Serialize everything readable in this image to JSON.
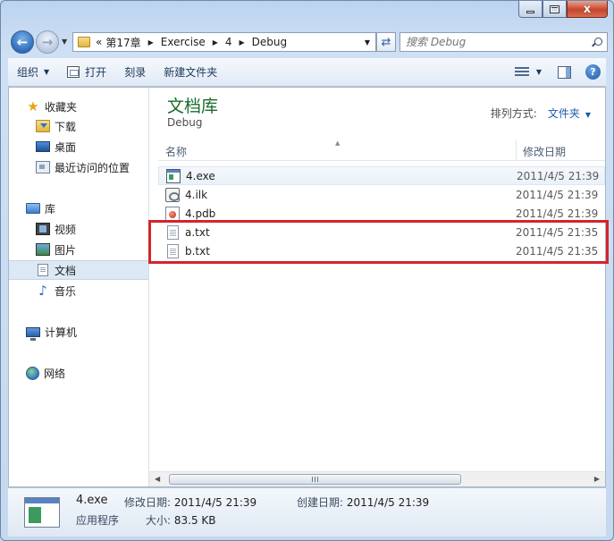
{
  "window": {
    "minimize_label": "",
    "close_glyph": "x"
  },
  "address": {
    "overflow": "«",
    "crumbs": [
      "第17章",
      "Exercise",
      "4",
      "Debug"
    ],
    "search_placeholder": "搜索 Debug"
  },
  "toolbar": {
    "organize": "组织",
    "open": "打开",
    "burn": "刻录",
    "new_folder": "新建文件夹"
  },
  "nav": {
    "favorites": "收藏夹",
    "downloads": "下载",
    "desktop": "桌面",
    "recent": "最近访问的位置",
    "libraries": "库",
    "videos": "视频",
    "pictures": "图片",
    "documents": "文档",
    "music": "音乐",
    "computer": "计算机",
    "network": "网络"
  },
  "library": {
    "title": "文档库",
    "subtitle": "Debug",
    "arrange_label": "排列方式:",
    "arrange_value": "文件夹"
  },
  "columns": {
    "name": "名称",
    "date": "修改日期"
  },
  "files": [
    {
      "name": "4.exe",
      "date": "2011/4/5 21:39",
      "icon": "exe-icon"
    },
    {
      "name": "4.ilk",
      "date": "2011/4/5 21:39",
      "icon": "ilk-icon"
    },
    {
      "name": "4.pdb",
      "date": "2011/4/5 21:39",
      "icon": "pdb-icon"
    },
    {
      "name": "a.txt",
      "date": "2011/4/5 21:35",
      "icon": "txt-icon"
    },
    {
      "name": "b.txt",
      "date": "2011/4/5 21:35",
      "icon": "txt-icon"
    }
  ],
  "details": {
    "name": "4.exe",
    "type": "应用程序",
    "modified_label": "修改日期:",
    "modified_value": "2011/4/5 21:39",
    "created_label": "创建日期:",
    "created_value": "2011/4/5 21:39",
    "size_label": "大小:",
    "size_value": "83.5 KB"
  },
  "colors": {
    "highlight": "#d1262b",
    "library_title": "#1a6b2c",
    "accent": "#1f5aa8"
  }
}
